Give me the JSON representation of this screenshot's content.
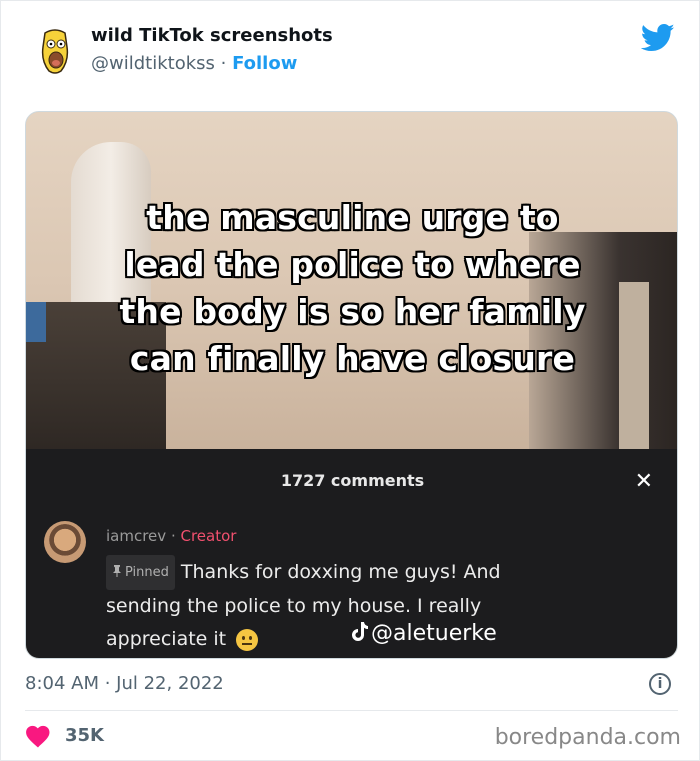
{
  "header": {
    "display_name": "wild TikTok screenshots",
    "handle": "@wildtiktokss",
    "separator": " · ",
    "follow_label": "Follow"
  },
  "media": {
    "caption_lines": [
      "the masculine urge to",
      "lead the police to where",
      "the body is so her family",
      "can finally have closure"
    ],
    "comments_title": "1727 comments",
    "close_symbol": "✕",
    "comment": {
      "username": "iamcrev",
      "separator": " · ",
      "role": "Creator",
      "pinned_label": "Pinned",
      "text_line1": "Thanks for doxxing me guys! And",
      "text_line2": "sending the police to my house. I really",
      "text_line3": "appreciate it"
    },
    "watermark": "@aletuerke"
  },
  "footer": {
    "timestamp": "8:04 AM · Jul 22, 2022",
    "info_symbol": "i",
    "likes": "35K",
    "brand": "boredpanda.com"
  },
  "colors": {
    "accent": "#1d9bf0",
    "like": "#f91880",
    "creator": "#f0506e"
  },
  "icons": [
    "avatar-icon",
    "twitter-bird-icon",
    "close-icon",
    "pin-icon",
    "emoji-icon",
    "tiktok-icon",
    "info-icon",
    "heart-icon"
  ]
}
